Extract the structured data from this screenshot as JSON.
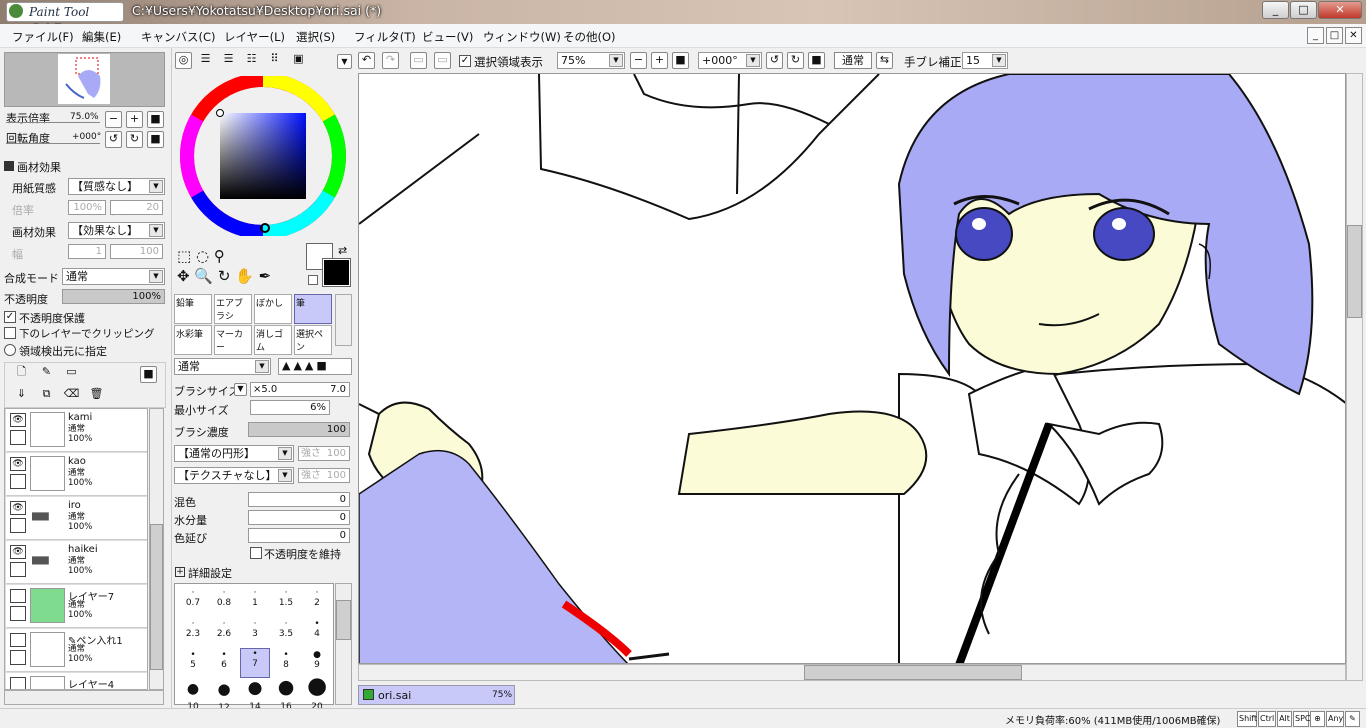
{
  "window": {
    "title": "C:¥Users¥Yokotatsu¥Desktop¥ori.sai (*)",
    "logo_text": "Paint Tool",
    "logo_bold": "SAI",
    "min_label": "_",
    "max_label": "□",
    "close_label": "✕"
  },
  "menu": [
    "ファイル(F)",
    "編集(E)",
    "キャンバス(C)",
    "レイヤー(L)",
    "選択(S)",
    "フィルタ(T)",
    "ビュー(V)",
    "ウィンドウ(W)",
    "その他(O)"
  ],
  "navigator": {
    "zoom_label": "表示倍率",
    "zoom_value": "75.0%",
    "rotate_label": "回転角度",
    "rotate_value": "+000°"
  },
  "texture": {
    "section": "画材効果",
    "paper_label": "用紙質感",
    "paper_value": "【質感なし】",
    "scale_label": "倍率",
    "scale_value": "100%",
    "strength_label": "強さ",
    "strength_value": "20",
    "effect_label": "画材効果",
    "effect_value": "【効果なし】",
    "width_label": "幅",
    "width_value": "1",
    "strength2_value": "100"
  },
  "layer_props": {
    "blend_label": "合成モード",
    "blend_value": "通常",
    "opacity_label": "不透明度",
    "opacity_value": "100%",
    "protect_label": "不透明度保護",
    "clip_label": "下のレイヤーでクリッピング",
    "source_label": "領域検出元に指定"
  },
  "layers": [
    {
      "name": "kami",
      "mode": "通常",
      "opacity": "100%"
    },
    {
      "name": "kao",
      "mode": "通常",
      "opacity": "100%"
    },
    {
      "name": "iro",
      "mode": "通常",
      "opacity": "100%"
    },
    {
      "name": "haikei",
      "mode": "通常",
      "opacity": "100%"
    },
    {
      "name": "レイヤー7",
      "mode": "通常",
      "opacity": "100%"
    },
    {
      "name": "ペン入れ1",
      "mode": "通常",
      "opacity": "100%"
    },
    {
      "name": "レイヤー4",
      "mode": "",
      "opacity": ""
    }
  ],
  "tools": {
    "row1": [
      "鉛筆",
      "エアブラシ",
      "ぼかし",
      "筆"
    ],
    "row2": [
      "水彩筆",
      "マーカー",
      "消しゴム",
      "選択ペン"
    ]
  },
  "brush": {
    "mode": "通常",
    "size_label": "ブラシサイズ",
    "size_mult": "×5.0",
    "size_value": "7.0",
    "min_label": "最小サイズ",
    "min_value": "6%",
    "density_label": "ブラシ濃度",
    "density_value": "100",
    "shape": "【通常の円形】",
    "shape_strength": "強さ",
    "shape_strength_value": "100",
    "texture": "【テクスチャなし】",
    "texture_strength_value": "100",
    "blend_label": "混色",
    "blend_value": "0",
    "water_label": "水分量",
    "water_value": "0",
    "stretch_label": "色延び",
    "stretch_value": "0",
    "keep_label": "不透明度を維持",
    "detail_label": "詳細設定"
  },
  "brush_sizes": [
    [
      "0.7",
      "0.8",
      "1",
      "1.5",
      "2"
    ],
    [
      "2.3",
      "2.6",
      "3",
      "3.5",
      "4"
    ],
    [
      "5",
      "6",
      "7",
      "8",
      "9"
    ],
    [
      "10",
      "12",
      "14",
      "16",
      "20"
    ]
  ],
  "canvas_toolbar": {
    "sel_label": "選択領域表示",
    "zoom": "75%",
    "angle": "+000°",
    "blend": "通常",
    "stab_label": "手ブレ補正",
    "stab_value": "15"
  },
  "file_tab": {
    "name": "ori.sai",
    "zoom": "75%"
  },
  "status": {
    "memory": "メモリ負荷率:60% (411MB使用/1006MB確保)",
    "keys": [
      "Shift",
      "Ctrl",
      "Alt",
      "SPC",
      "⊕",
      "Any",
      "✎"
    ]
  },
  "colors": {
    "hair": "#a9aaf5",
    "skin": "#fbfbd8",
    "accent": "#c9c9f9"
  }
}
